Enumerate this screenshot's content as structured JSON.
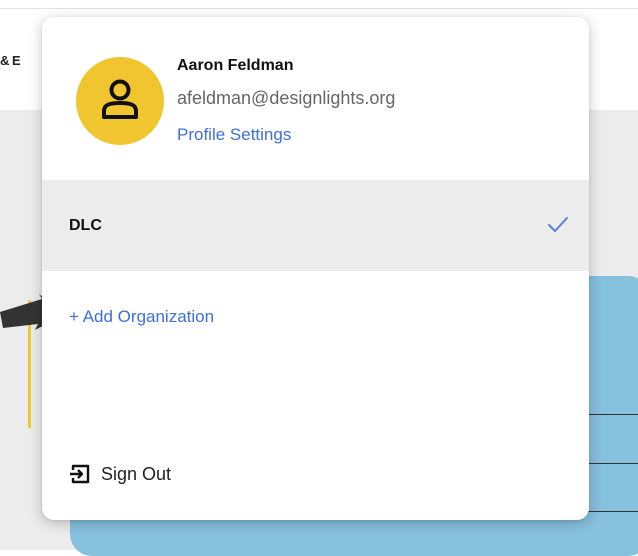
{
  "background": {
    "partial_text": "& E"
  },
  "profile": {
    "name": "Aaron Feldman",
    "email": "afeldman@designlights.org",
    "settings_link": "Profile Settings",
    "avatar_icon": "user-icon",
    "avatar_color": "#f1c530"
  },
  "organizations": {
    "items": [
      {
        "label": "DLC",
        "selected": true,
        "icon": "checkmark-icon"
      }
    ],
    "add_label": "+ Add Organization"
  },
  "sign_out": {
    "label": "Sign Out",
    "icon": "sign-out-icon"
  },
  "colors": {
    "link": "#3f6fd8",
    "selected_row": "#ececec",
    "check": "#5a7fd6",
    "blue_card": "#86c1de"
  }
}
